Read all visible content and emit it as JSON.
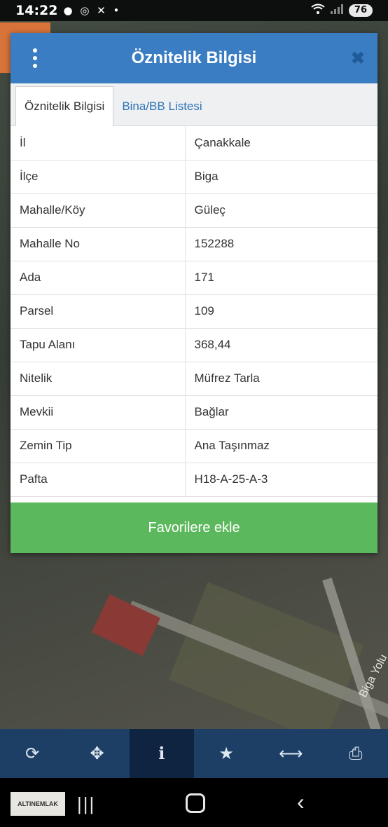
{
  "status_bar": {
    "time": "14:22",
    "notification_icons": "● ◎ ✕ •",
    "battery": "76"
  },
  "map": {
    "street_label": "Biga Yolu"
  },
  "dialog": {
    "title": "Öznitelik Bilgisi",
    "close_symbol": "✖",
    "tabs": [
      {
        "label": "Öznitelik Bilgisi",
        "active": true
      },
      {
        "label": "Bina/BB Listesi",
        "active": false
      }
    ],
    "rows": [
      {
        "key": "İl",
        "value": "Çanakkale"
      },
      {
        "key": "İlçe",
        "value": "Biga"
      },
      {
        "key": "Mahalle/Köy",
        "value": "Güleç"
      },
      {
        "key": "Mahalle No",
        "value": "152288"
      },
      {
        "key": "Ada",
        "value": "171"
      },
      {
        "key": "Parsel",
        "value": "109"
      },
      {
        "key": "Tapu Alanı",
        "value": "368,44"
      },
      {
        "key": "Nitelik",
        "value": "Müfrez Tarla"
      },
      {
        "key": "Mevkii",
        "value": "Bağlar"
      },
      {
        "key": "Zemin Tip",
        "value": "Ana Taşınmaz"
      },
      {
        "key": "Pafta",
        "value": "H18-A-25-A-3"
      }
    ],
    "favorite_button": "Favorilere ekle"
  },
  "toolbar": {
    "items": [
      {
        "icon": "refresh-icon",
        "glyph": "⟳"
      },
      {
        "icon": "move-icon",
        "glyph": "✥"
      },
      {
        "icon": "info-icon",
        "glyph": "ℹ",
        "active": true
      },
      {
        "icon": "star-icon",
        "glyph": "★"
      },
      {
        "icon": "measure-icon",
        "glyph": "⟷"
      },
      {
        "icon": "print-icon",
        "glyph": "⎙"
      }
    ]
  },
  "nav_bar": {
    "logo_text": "ALTINEMLAK",
    "recent_glyph": "|||",
    "back_glyph": "‹"
  },
  "colors": {
    "header": "#3a7dc2",
    "favorite_button": "#5cb85c",
    "toolbar": "#1d3f66",
    "toolbar_active": "#0f2440"
  }
}
